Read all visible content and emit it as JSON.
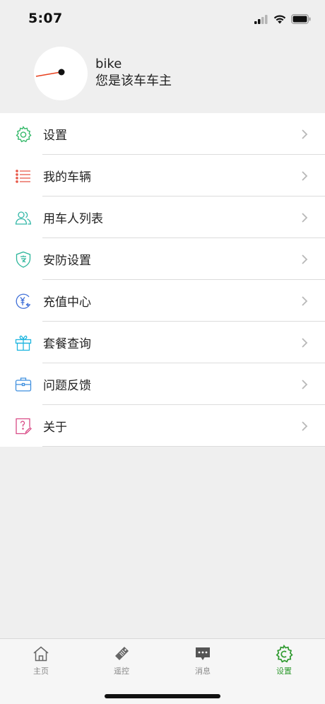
{
  "status_bar": {
    "time": "5:07",
    "signal_icon": "cellular-signal-icon",
    "wifi_icon": "wifi-icon",
    "battery_icon": "battery-icon"
  },
  "profile": {
    "name": "bike",
    "role": "您是该车车主",
    "avatar_icon": "gauge-icon"
  },
  "menu": {
    "items": [
      {
        "label": "设置",
        "icon": "gear-icon",
        "color": "#35b96a"
      },
      {
        "label": "我的车辆",
        "icon": "list-icon",
        "color": "#e85b4b"
      },
      {
        "label": "用车人列表",
        "icon": "users-icon",
        "color": "#33b7a7"
      },
      {
        "label": "安防设置",
        "icon": "shield-icon",
        "color": "#2bb59a"
      },
      {
        "label": "充值中心",
        "icon": "recharge-icon",
        "color": "#3f6fd8"
      },
      {
        "label": "套餐查询",
        "icon": "gift-icon",
        "color": "#1fb6e0"
      },
      {
        "label": "问题反馈",
        "icon": "briefcase-icon",
        "color": "#3f8fdf"
      },
      {
        "label": "关于",
        "icon": "about-icon",
        "color": "#d94a86"
      }
    ]
  },
  "tabs": [
    {
      "label": "主页",
      "icon": "home-icon",
      "active": false
    },
    {
      "label": "遥控",
      "icon": "remote-icon",
      "active": false
    },
    {
      "label": "消息",
      "icon": "message-icon",
      "active": false
    },
    {
      "label": "设置",
      "icon": "settings-tab-icon",
      "active": true
    }
  ],
  "colors": {
    "accent": "#2f9a2f",
    "background": "#efefef",
    "tab_inactive": "#888888"
  }
}
